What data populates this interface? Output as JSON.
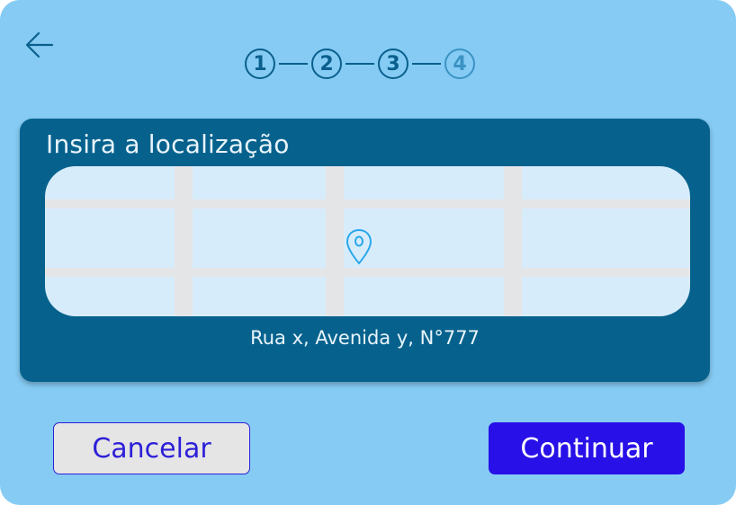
{
  "app": {
    "background_color": "#85cbf3",
    "accent_color": "#2810e8"
  },
  "header": {
    "back_icon": "arrow-left-icon",
    "stepper": {
      "steps": [
        {
          "label": "1",
          "state": "done"
        },
        {
          "label": "2",
          "state": "done"
        },
        {
          "label": "3",
          "state": "current"
        },
        {
          "label": "4",
          "state": "pending"
        }
      ]
    }
  },
  "location_card": {
    "title": "Insira a localização",
    "map_pin_icon": "map-pin-icon",
    "address": "Rua x, Avenida y, N°777"
  },
  "actions": {
    "cancel_label": "Cancelar",
    "continue_label": "Continuar"
  }
}
